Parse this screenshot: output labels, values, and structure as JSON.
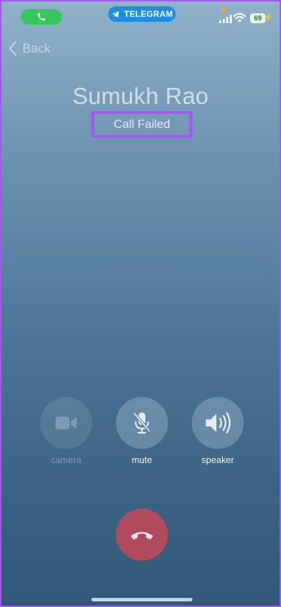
{
  "status_bar": {
    "app_pill_label": "TELEGRAM",
    "battery_level": "69",
    "active_call_color": "#34c759",
    "telegram_color": "#1a8fe3"
  },
  "nav": {
    "back_label": "Back"
  },
  "call": {
    "caller_name": "Sumukh Rao",
    "status": "Call Failed"
  },
  "controls": [
    {
      "label": "camera",
      "icon": "video-camera-icon",
      "enabled": false
    },
    {
      "label": "mute",
      "icon": "microphone-slash-icon",
      "enabled": true
    },
    {
      "label": "speaker",
      "icon": "speaker-icon",
      "enabled": true
    }
  ],
  "end_call": {
    "icon": "hang-up-icon",
    "color": "#b04a5c"
  },
  "highlight_color": "#a855f7"
}
